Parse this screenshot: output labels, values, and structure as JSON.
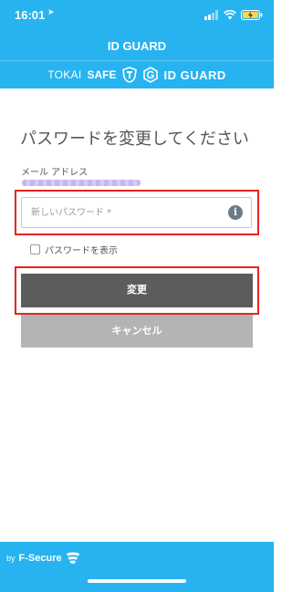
{
  "status_bar": {
    "time": "16:01",
    "location_icon": "location-arrow-icon",
    "icons": [
      "signal-icon",
      "wifi-icon",
      "battery-charging-icon"
    ]
  },
  "header": {
    "title": "ID GUARD"
  },
  "brand_bar": {
    "tokai": "TOKAI",
    "safe": "SAFE",
    "id_guard": "ID GUARD"
  },
  "form": {
    "title": "パスワードを変更してください",
    "email_label": "メール アドレス",
    "password_placeholder": "新しいパスワード *",
    "show_password_label": "パスワードを表示",
    "change_button": "変更",
    "cancel_button": "キャンセル"
  },
  "footer": {
    "by": "by",
    "brand": "F-Secure"
  },
  "colors": {
    "brand_blue": "#27b3f0",
    "highlight_red": "#e8231f",
    "primary_button": "#5c5c5c",
    "secondary_button": "#b4b4b4"
  }
}
